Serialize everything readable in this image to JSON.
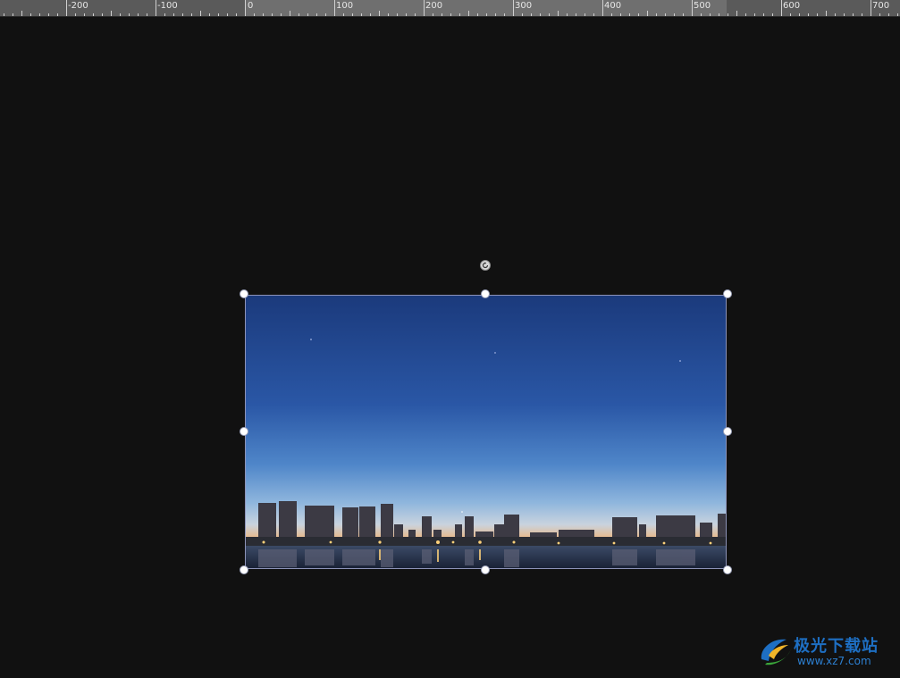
{
  "ruler": {
    "labels": [
      "-200",
      "-100",
      "0",
      "100",
      "200",
      "300",
      "400",
      "500",
      "600",
      "700"
    ],
    "highlight_color": "#6f6f6f",
    "background_color": "#5a5a5a"
  },
  "canvas": {
    "background_color": "#111111"
  },
  "image": {
    "subject": "city skyline at dusk reflected in water",
    "border_color": "#8d93b8",
    "sky_top_color": "#1b3a7c",
    "sky_bottom_color": "#e8b98a"
  },
  "selection": {
    "handle_color": "#ffffff",
    "handle_icon": "circle-resize-handle",
    "rotate_icon": "rotate-icon"
  },
  "watermark": {
    "name": "极光下载站",
    "url": "www.xz7.com",
    "logo_icon": "aurora-logo-icon",
    "color": "#1e6fc3"
  }
}
